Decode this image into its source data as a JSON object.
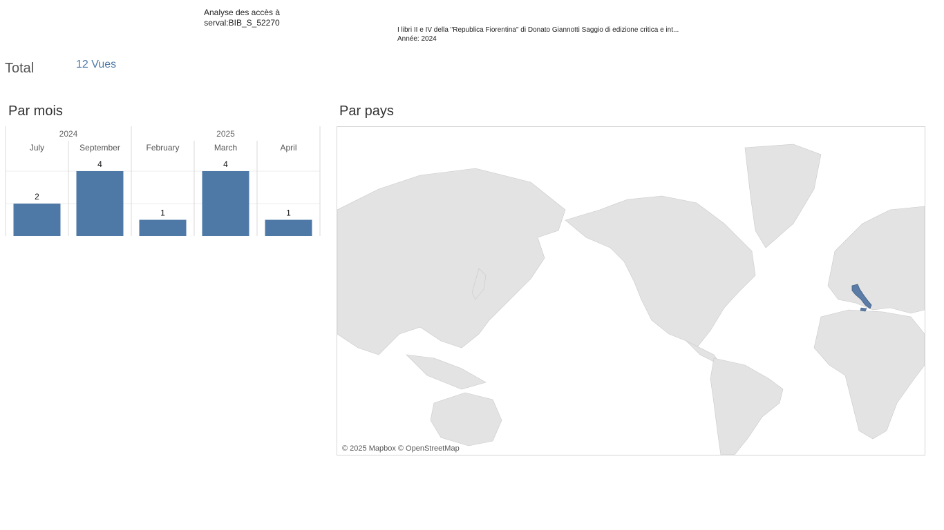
{
  "header": {
    "title_line1": "Analyse des accès à",
    "title_line2": "serval:BIB_S_52270"
  },
  "document": {
    "title": "I libri II e IV della \"Republica Fiorentina\" di Donato Giannotti Saggio di edizione critica e int...",
    "year_line": "Année: 2024"
  },
  "total": {
    "label": "Total",
    "value": "12 Vues"
  },
  "sections": {
    "by_month": "Par mois",
    "by_country": "Par pays"
  },
  "chart_data": [
    {
      "type": "bar",
      "title": "Par mois",
      "years": [
        {
          "label": "2024",
          "months": [
            "July",
            "September"
          ]
        },
        {
          "label": "2025",
          "months": [
            "February",
            "March",
            "April"
          ]
        }
      ],
      "categories": [
        "July",
        "September",
        "February",
        "March",
        "April"
      ],
      "values": [
        2,
        4,
        1,
        4,
        1
      ],
      "ylim": [
        0,
        4
      ],
      "color": "#4e79a7",
      "grid": true
    },
    {
      "type": "map",
      "title": "Par pays",
      "highlighted_countries": [
        "Italy"
      ],
      "highlight_color": "#5b7ca6",
      "attribution": "© 2025 Mapbox © OpenStreetMap"
    }
  ]
}
